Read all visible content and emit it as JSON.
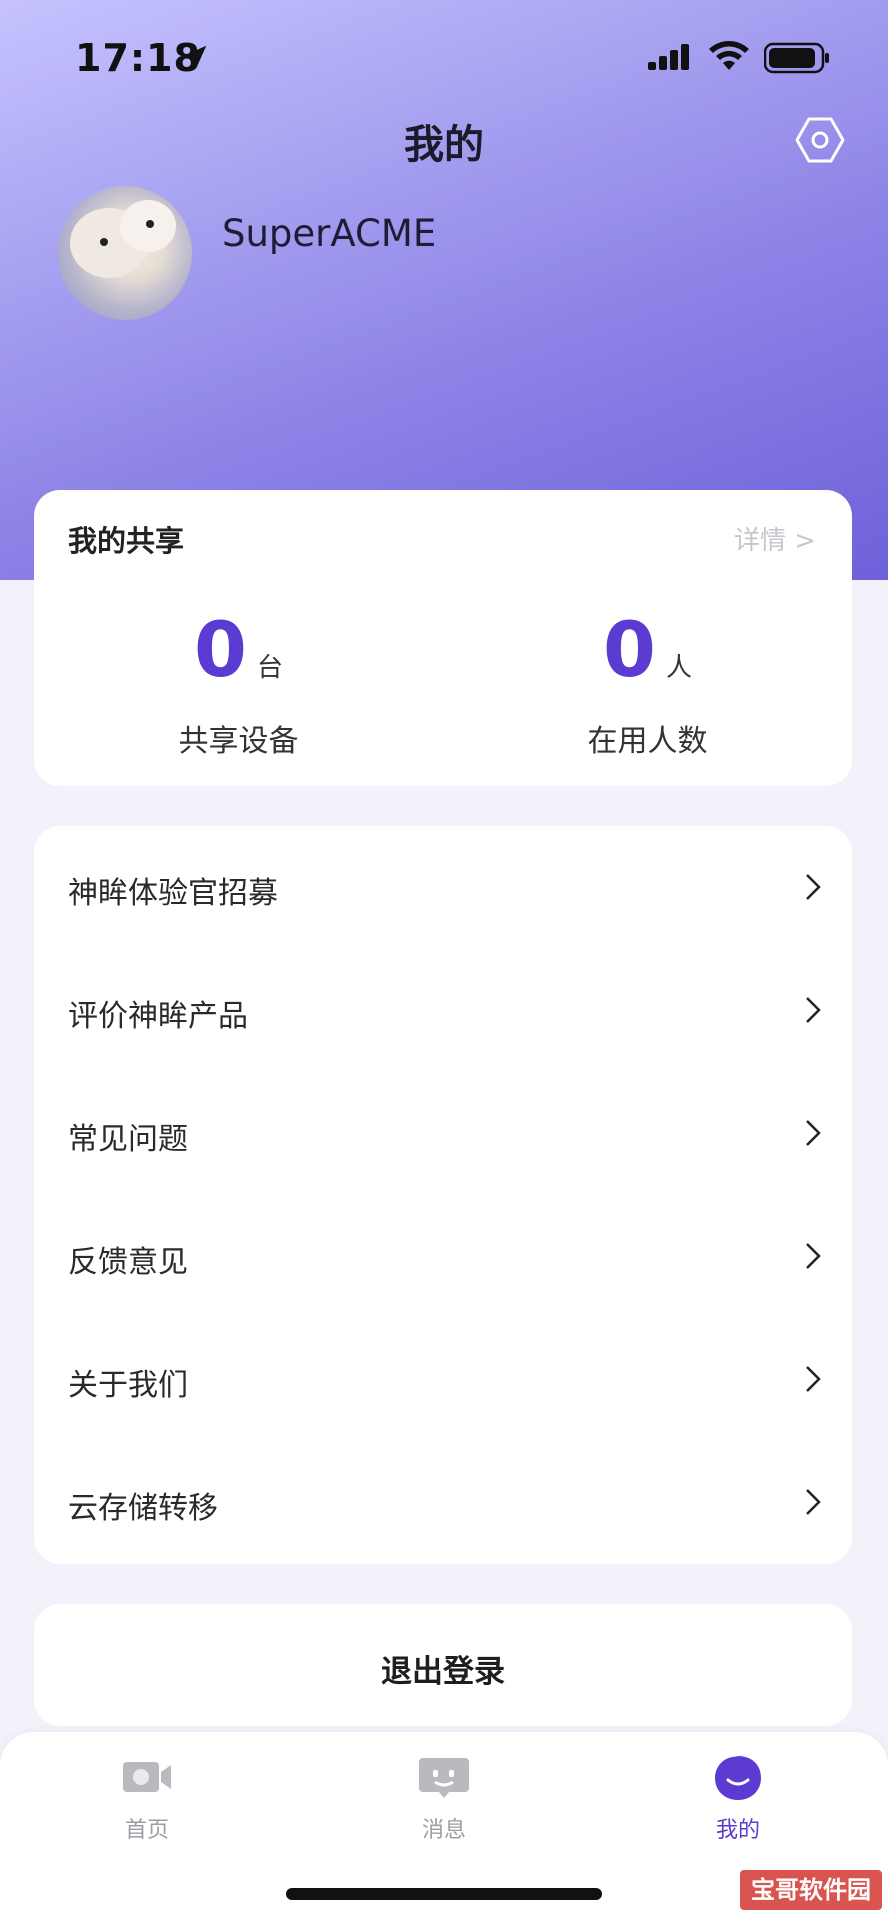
{
  "status_bar": {
    "time": "17:18"
  },
  "header": {
    "title": "我的"
  },
  "profile": {
    "username": "SuperACME"
  },
  "share": {
    "title": "我的共享",
    "detail_label": "详情 >",
    "stats": [
      {
        "value": "0",
        "unit": "台",
        "label": "共享设备"
      },
      {
        "value": "0",
        "unit": "人",
        "label": "在用人数"
      }
    ]
  },
  "menu": {
    "items": [
      {
        "label": "神眸体验官招募"
      },
      {
        "label": "评价神眸产品"
      },
      {
        "label": "常见问题"
      },
      {
        "label": "反馈意见"
      },
      {
        "label": "关于我们"
      },
      {
        "label": "云存储转移"
      }
    ]
  },
  "logout": {
    "label": "退出登录"
  },
  "tabs": [
    {
      "label": "首页",
      "icon": "camera-icon",
      "active": false
    },
    {
      "label": "消息",
      "icon": "message-icon",
      "active": false
    },
    {
      "label": "我的",
      "icon": "profile-icon",
      "active": true
    }
  ],
  "watermark": {
    "text": "宝哥软件园"
  },
  "colors": {
    "accent": "#5b3bd1",
    "header_gradient_start": "#c6c3ff",
    "header_gradient_end": "#6f61d9"
  }
}
